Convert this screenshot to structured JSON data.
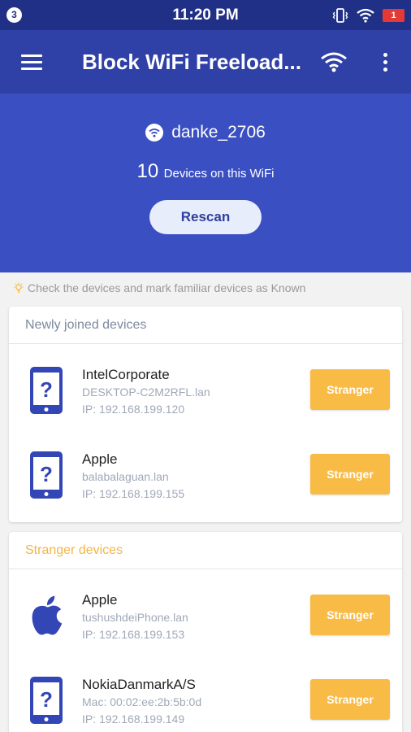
{
  "status_bar": {
    "notification_count": "3",
    "time": "11:20 PM",
    "battery": "1"
  },
  "app_bar": {
    "title": "Block WiFi Freeload..."
  },
  "network": {
    "ssid": "danke_2706",
    "device_count": "10",
    "device_count_label": "Devices on this WiFi",
    "rescan_label": "Rescan"
  },
  "tip": "Check the devices and mark familiar devices as Known",
  "sections": {
    "newly_joined": {
      "title": "Newly joined devices",
      "devices": [
        {
          "name": "IntelCorporate",
          "host": "DESKTOP-C2M2RFL.lan",
          "ip": "IP: 192.168.199.120",
          "icon": "phone-question-icon",
          "status": "Stranger"
        },
        {
          "name": "Apple",
          "host": "balabalaguan.lan",
          "ip": "IP: 192.168.199.155",
          "icon": "phone-question-icon",
          "status": "Stranger"
        }
      ]
    },
    "stranger": {
      "title": "Stranger devices",
      "devices": [
        {
          "name": "Apple",
          "host": "tushushdeiPhone.lan",
          "ip": "IP: 192.168.199.153",
          "icon": "apple-logo-icon",
          "status": "Stranger"
        },
        {
          "name": "NokiaDanmarkA/S",
          "host": "Mac: 00:02:ee:2b:5b:0d",
          "ip": "IP: 192.168.199.149",
          "icon": "phone-question-icon",
          "status": "Stranger"
        }
      ]
    }
  },
  "colors": {
    "status_bar": "#213087",
    "app_bar": "#2f40a6",
    "hero": "#3a4fc2",
    "stranger_button": "#f8bb46",
    "stranger_section_title": "#f5b545",
    "device_icon": "#3346b5"
  }
}
